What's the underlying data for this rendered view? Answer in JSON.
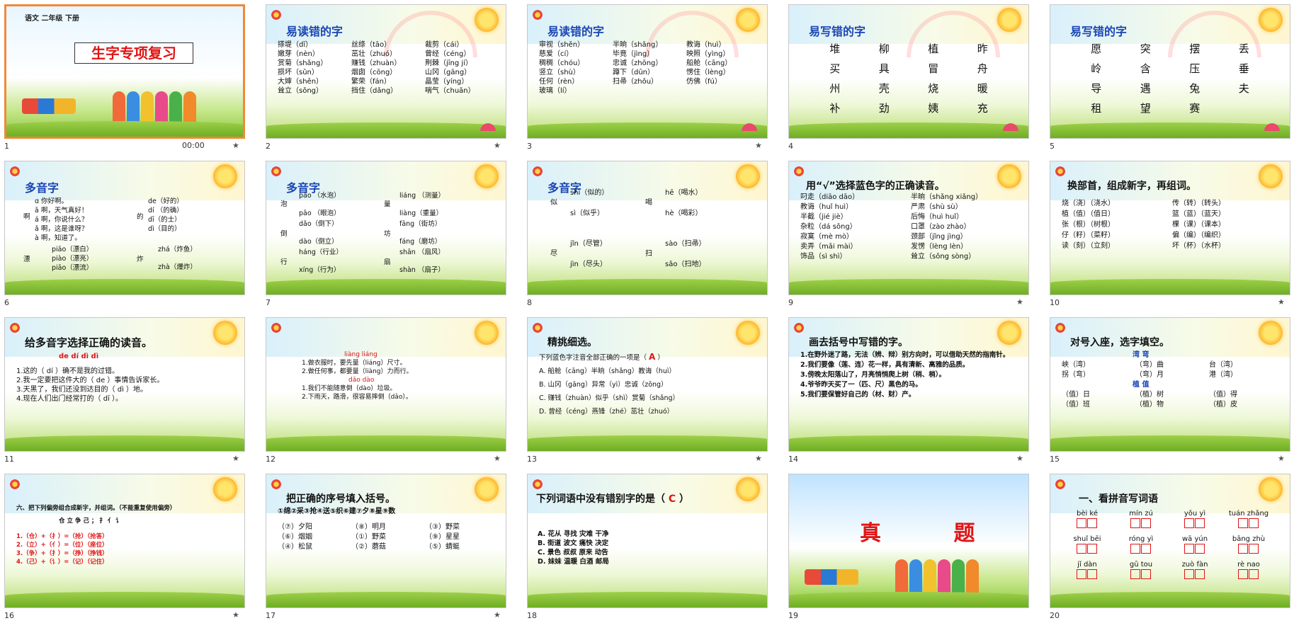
{
  "slides": [
    {
      "number": "1",
      "subtitle": "语文  二年级  下册",
      "title": "生字专项复习",
      "time": "00:00"
    },
    {
      "number": "2",
      "title": "易读错的字",
      "items": [
        "搽堤（dī）",
        "丝绦（tāo）",
        "裁剪（cái）",
        "嫩芽（nèn）",
        "茁壮（zhuó）",
        "曾经（céng）",
        "赏菊（shǎng）",
        "赚钱（zhuàn）",
        "荆棘（jīng jí）",
        "损坏（sǔn）",
        "烟囱（cōng）",
        "山冈（gāng）",
        "大婶（shěn）",
        "繁荣（fán）",
        "晶莹（yíng）",
        "耸立（sǒng）",
        "挡住（dǎng）",
        "喘气（chuǎn）"
      ]
    },
    {
      "number": "3",
      "title": "易读错的字",
      "items": [
        "审视（shěn）",
        "半晌（shǎng）",
        "教诲（huì）",
        "慈爱（cí）",
        "毕竟（jìng）",
        "映照（yìng）",
        "稠稠（chóu）",
        "忠诚（zhōng）",
        "船舱（cāng）",
        "竖立（shù）",
        "蹲下（dūn）",
        "愣住（lèng）",
        "任何（rèn）",
        "扫帚（zhǒu）",
        "仿佛（fú）",
        "玻璃（lí）"
      ]
    },
    {
      "number": "4",
      "title": "易写错的字",
      "chars": [
        "堆",
        "柳",
        "植",
        "昨",
        "买",
        "具",
        "冒",
        "舟",
        "州",
        "壳",
        "烧",
        "暖",
        "补",
        "劲",
        "姨",
        "充"
      ]
    },
    {
      "number": "5",
      "title": "易写错的字",
      "chars": [
        "愿",
        "突",
        "摆",
        "丢",
        "岭",
        "含",
        "压",
        "垂",
        "导",
        "遇",
        "兔",
        "夫",
        "租",
        "望",
        "赛"
      ]
    },
    {
      "number": "6",
      "title": "多音字",
      "lines": [
        "ɑ 你好啊。",
        "ā 啊，天气真好！",
        "á 啊，你说什么？",
        "ǎ 啊，这是谁呀？",
        "à 啊，知道了。",
        "de（好的）",
        "dí （的确）",
        "dī（的士）",
        "dì（目的）",
        "piāo（漂白）",
        "piào（漂亮）",
        "piāo（漂流）",
        "zhá（炸鱼）",
        "zhà（爆炸）"
      ],
      "heads": [
        "啊",
        "的",
        "漂",
        "炸"
      ]
    },
    {
      "number": "7",
      "title": "多音字",
      "lines": [
        "pào （水泡）",
        "pāo （眼泡）",
        "liáng （测量）",
        "liàng（重量）",
        "dǎo（倒下）",
        "dào（倒立）",
        "fāng（街坊）",
        "fáng（磨坊）",
        "háng（行业）",
        "xíng（行为）",
        "shān （扇风）",
        "shàn （扇子）"
      ],
      "heads": [
        "泡",
        "量",
        "倒",
        "坊",
        "行",
        "扇"
      ]
    },
    {
      "number": "8",
      "title": "多音字",
      "lines": [
        "shì（似的）",
        "sì（似乎）",
        "hē（喝水）",
        "hè（喝彩）",
        "jǐn（尽管）",
        "jìn（尽头）",
        "sào（扫帚）",
        "sǎo（扫地）"
      ],
      "heads": [
        "似",
        "喝",
        "尽",
        "扫"
      ]
    },
    {
      "number": "9",
      "title": "用“√”选择蓝色字的正确读音。",
      "items": [
        "叼走（diāo dāo）",
        "半晌（shǎng xiǎng）",
        "教诲（huǐ huì）",
        "严肃（shù sù）",
        "半截（jié jiè）",
        "后悔（huì huǐ）",
        "杂粒（dá sǒng）",
        "口罩（zào zhào）",
        "寂寞（mè mò）",
        "颈部（jǐng jìng）",
        "卖弄（mǎi mài）",
        "发愣（lèng lèn）",
        "饰品（sì shì）",
        "耸立（sǒng sòng）"
      ]
    },
    {
      "number": "10",
      "title": "换部首，组成新字，再组词。",
      "items": [
        "烧（浇）（浇水）",
        "传（转）（转头）",
        "植（值）（值日）",
        "篮（蓝）（蓝天）",
        "张（根）（树根）",
        "棵（课）（课本）",
        "仔（籽）（菜籽）",
        "偏（编）（编织）",
        "读（刻）（立刻）",
        "坏（杯）（水杯）"
      ]
    },
    {
      "number": "11",
      "title": "给多音字选择正确的读音。",
      "options": "de    dí     dì     dì",
      "lines": [
        "1.这的（ dí ）确不是我的过错。",
        "2.我一定要把这件大的（ de ）事情告诉家长。",
        "3.天黑了，我们还没到达目的（ dì ）地。",
        "4.现在人们出门经常打的（ dī ）。"
      ]
    },
    {
      "number": "12",
      "top": "liàng    liáng",
      "lines": [
        "1.做衣服时，要先量（liáng）尺寸。",
        "2.做任何事，都要量（liàng）力而行。",
        "dǎo         dào",
        "1.我们不能随意倒（dào）垃圾。",
        "2.下雨天，路滑，很容易摔倒（dǎo）。"
      ]
    },
    {
      "number": "13",
      "title": "精挑细选。",
      "question": "下列蓝色字注音全部正确的一项是（",
      "answer": "A",
      "close": "）",
      "lines": [
        "A. 船舱（cāng）半晌（shǎng）教诲（huì）",
        "B. 山冈（gāng）异常（yì）忠诚（zōng）",
        "C. 赚钱（zhuàn）似乎（shì）赏菊（shǎng）",
        "D. 曾经（céng）燕锋（zhé）茁壮（zhuó）"
      ]
    },
    {
      "number": "14",
      "title": "画去括号中写错的字。",
      "lines": [
        "1.在野外迷了路，无法（辨、辩）别方向时，可以借助天然的指南针。",
        "2.我们要像（莲、连）花一样，具有清新、高雅的品质。",
        "3.傍晚太阳落山了，月亮悄悄爬上树（稍、梢）。",
        "4.爷爷昨天买了一（匹、尺）黑色的马。",
        "5.我们要保管好自己的（材、财）产。"
      ]
    },
    {
      "number": "15",
      "title": "对号入座，选字填空。",
      "heads1": "湾       弯",
      "rows1": [
        "峡（湾）",
        "（弯）曲",
        "台（湾）",
        "拐（弯）",
        "（弯）月",
        "港（湾）"
      ],
      "heads2": "植       值",
      "rows2": [
        "（值）日",
        "（植）树",
        "（值）得",
        "（值）班",
        "（植）物",
        "（植）皮"
      ]
    },
    {
      "number": "16",
      "title": "六、把下列偏旁组合成新字，并组词。（不能重复使用偏旁）",
      "parts": "仓  立  争  己  ；  扌  亻  讠",
      "lines": [
        "1.（仓）+（扌）=（抢）（抢答）",
        "2.（立）+（亻）=（位）（座位）",
        "3.（争）+（扌）=（挣）（挣钱）",
        "4.（己）+（讠）=（记）（记住）"
      ]
    },
    {
      "number": "17",
      "title": "把正确的序号填入括号。",
      "options": "①绵②采③抢④送⑤织⑥建⑦夕⑧星⑨数",
      "items": [
        "（⑦）夕阳",
        "（⑧）明月",
        "（③）野菜",
        "（⑥）烟姻",
        "（①）野菜",
        "（⑨）星星",
        "（④）松鼠",
        "（②）蘑菇",
        "（⑤）蜻蜓"
      ]
    },
    {
      "number": "18",
      "title": "下列词语中没有错别字的是（",
      "answer": "C",
      "close": "）",
      "lines": [
        "A. 花从  寻找  灾难  干净",
        "B. 街道  波文  痛快  决定",
        "C. 景色  叔叔  原来  动告",
        "D. 妹妹  温暖  白酒  邮局"
      ]
    },
    {
      "number": "19",
      "title": "真  题"
    },
    {
      "number": "20",
      "title": "一、看拼音写词语",
      "words": [
        "bèi ké",
        "mín zú",
        "yǒu yì",
        "tuán zhǎng",
        "shuǐ bēi",
        "róng yì",
        "wā yún",
        "bāng zhù",
        "jǐ dàn",
        "gū tou",
        "zuò fàn",
        "rè nao"
      ]
    }
  ]
}
